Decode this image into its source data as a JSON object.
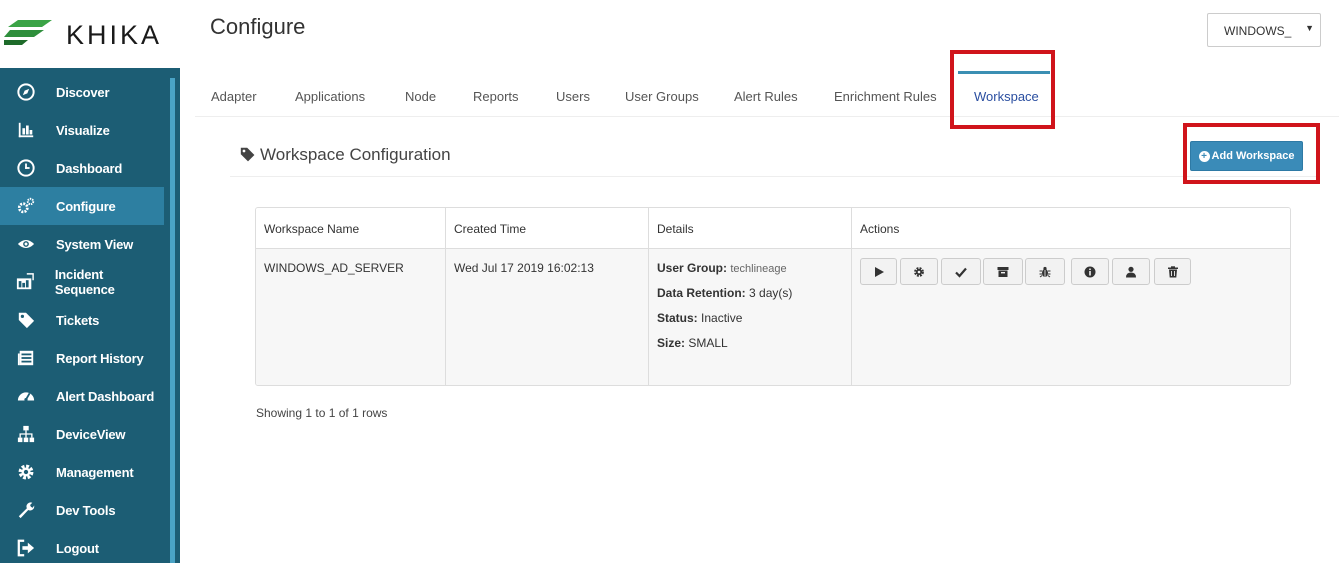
{
  "brand": {
    "name": "KHIKA",
    "logo_icon": "khika-stripes-logo"
  },
  "sidebar": {
    "items": [
      {
        "label": "Discover",
        "icon": "compass-icon",
        "active": false
      },
      {
        "label": "Visualize",
        "icon": "bar-chart-icon",
        "active": false
      },
      {
        "label": "Dashboard",
        "icon": "dashboard-gauge-icon",
        "active": false
      },
      {
        "label": "Configure",
        "icon": "gears-icon",
        "active": true
      },
      {
        "label": "System View",
        "icon": "eye-icon",
        "active": false
      },
      {
        "label": "Incident Sequence",
        "icon": "sequence-chart-icon",
        "active": false
      },
      {
        "label": "Tickets",
        "icon": "tag-icon",
        "active": false
      },
      {
        "label": "Report History",
        "icon": "report-list-icon",
        "active": false
      },
      {
        "label": "Alert Dashboard",
        "icon": "speedometer-icon",
        "active": false
      },
      {
        "label": "DeviceView",
        "icon": "sitemap-icon",
        "active": false
      },
      {
        "label": "Management",
        "icon": "gear-icon",
        "active": false
      },
      {
        "label": "Dev Tools",
        "icon": "wrench-icon",
        "active": false
      },
      {
        "label": "Logout",
        "icon": "sign-out-icon",
        "active": false
      }
    ]
  },
  "header": {
    "title": "Configure",
    "workspace_select": {
      "value": "WINDOWS_"
    }
  },
  "tabs": [
    {
      "label": "Adapter",
      "active": false
    },
    {
      "label": "Applications",
      "active": false
    },
    {
      "label": "Node",
      "active": false
    },
    {
      "label": "Reports",
      "active": false
    },
    {
      "label": "Users",
      "active": false
    },
    {
      "label": "User Groups",
      "active": false
    },
    {
      "label": "Alert Rules",
      "active": false
    },
    {
      "label": "Enrichment Rules",
      "active": false
    },
    {
      "label": "Workspace",
      "active": true
    }
  ],
  "section": {
    "title": "Workspace Configuration",
    "add_button_label": "Add Workspace"
  },
  "table": {
    "columns": [
      "Workspace Name",
      "Created Time",
      "Details",
      "Actions"
    ],
    "rows": [
      {
        "name": "WINDOWS_AD_SERVER",
        "created": "Wed Jul 17 2019 16:02:13",
        "details": {
          "user_group_label": "User Group:",
          "user_group": "techlineage",
          "retention_label": "Data Retention:",
          "retention": "3 day(s)",
          "status_label": "Status:",
          "status": "Inactive",
          "size_label": "Size:",
          "size": "SMALL"
        },
        "actions": [
          "play-icon",
          "gear-icon",
          "check-icon",
          "archive-icon",
          "bug-icon",
          "info-icon",
          "user-icon",
          "trash-icon"
        ]
      }
    ]
  },
  "footer": {
    "pagination_text": "Showing 1 to 1 of 1 rows"
  },
  "colors": {
    "sidebar_bg": "#1c5d74",
    "sidebar_active": "#2d7fa1",
    "accent_blue": "#3a8bb8",
    "highlight_red": "#d0141b",
    "logo_green": "#3aa346"
  }
}
